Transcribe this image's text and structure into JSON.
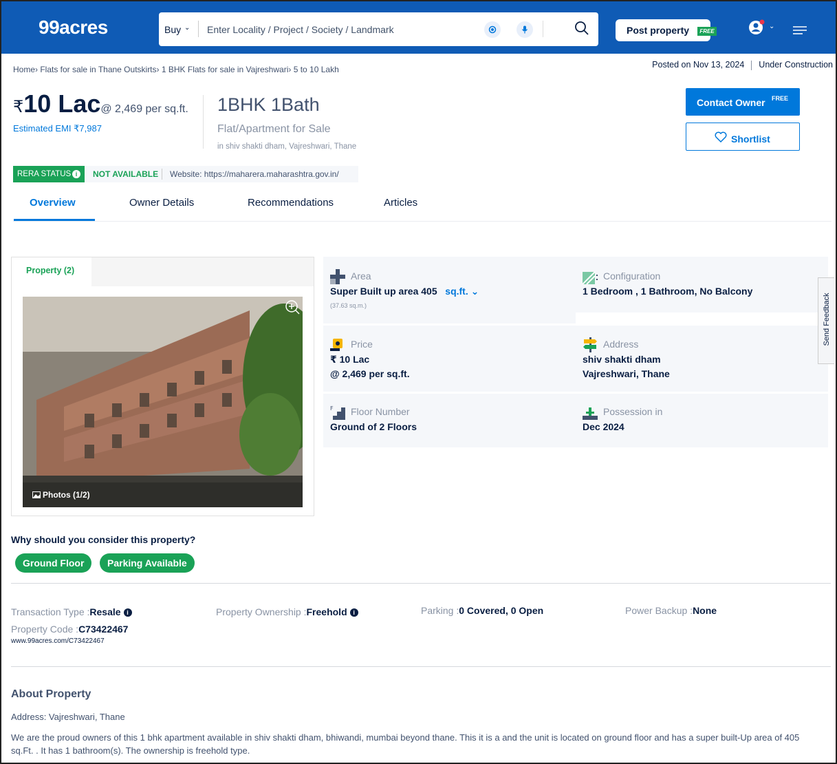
{
  "header": {
    "logo": "99acres",
    "search_type": "Buy",
    "search_placeholder": "Enter Locality / Project / Society / Landmark",
    "post_property": "Post property",
    "free_badge": "FREE"
  },
  "breadcrumb": "Home› Flats for sale in Thane Outskirts› 1 BHK Flats for sale in Vajreshwari› 5 to 10 Lakh",
  "posted_on": "Posted on Nov 13, 2024",
  "status": "Under Construction",
  "price": {
    "currency": "₹",
    "amount": "10 Lac",
    "per_sqft": "@ 2,469 per sq.ft.",
    "emi": "Estimated EMI ₹7,987"
  },
  "listing": {
    "title": "1BHK 1Bath",
    "type": "Flat/Apartment for Sale",
    "location": "in shiv shakti dham, Vajreshwari, Thane"
  },
  "actions": {
    "contact": "Contact Owner",
    "contact_sup": "FREE",
    "shortlist": "Shortlist"
  },
  "rera": {
    "label": "RERA STATUS",
    "status": "NOT AVAILABLE",
    "website": "Website: https://maharera.maharashtra.gov.in/"
  },
  "tabs": [
    "Overview",
    "Owner Details",
    "Recommendations",
    "Articles"
  ],
  "gallery": {
    "tab": "Property (2)",
    "photos": "Photos (1/2)"
  },
  "details": {
    "area_label": "Area",
    "area_value": "Super Built up area 405",
    "area_unit": "sq.ft.",
    "area_sqm": "(37.63 sq.m.)",
    "config_label": "Configuration",
    "config_value": "1 Bedroom , 1 Bathroom, No Balcony",
    "price_label": "Price",
    "price_value": "₹ 10 Lac",
    "price_sqft": "@ 2,469 per sq.ft.",
    "address_label": "Address",
    "address_line1": "shiv shakti dham",
    "address_line2": "Vajreshwari, Thane",
    "floor_label": "Floor Number",
    "floor_value": "Ground of 2 Floors",
    "possession_label": "Possession in",
    "possession_value": "Dec 2024"
  },
  "feedback": "Send Feedback",
  "why": {
    "title": "Why should you consider this property?",
    "chips": [
      "Ground Floor",
      "Parking Available"
    ]
  },
  "meta": {
    "transaction_k": "Transaction Type :",
    "transaction_v": "Resale",
    "ownership_k": "Property Ownership :",
    "ownership_v": "Freehold",
    "parking_k": "Parking :",
    "parking_v": "0 Covered, 0 Open",
    "power_k": "Power Backup :",
    "power_v": "None",
    "code_k": "Property Code :",
    "code_v": "C73422467",
    "url": "www.99acres.com/C73422467"
  },
  "about": {
    "title": "About Property",
    "address": "Address: Vajreshwari, Thane",
    "description": "We are the proud owners of this 1 bhk apartment available in shiv shakti dham, bhiwandi, mumbai beyond thane. This it is a and the unit is located on ground floor and has a super built-Up area of 405 sq.Ft. . It has 1 bathroom(s). The ownership is freehold type."
  },
  "colors": {
    "brand_blue": "#0f5bb5",
    "accent_blue": "#0078db",
    "green": "#1aa257"
  }
}
